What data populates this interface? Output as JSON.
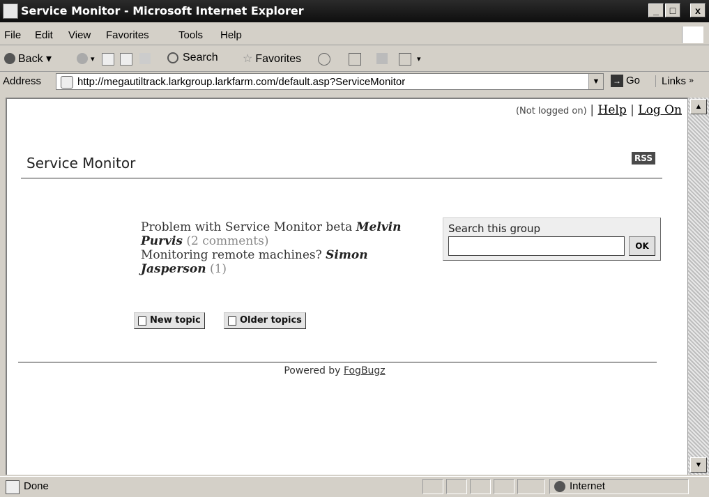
{
  "window": {
    "title": "Service Monitor - Microsoft Internet Explorer",
    "caption_buttons": [
      "_",
      "□",
      "x"
    ]
  },
  "menu": {
    "items": [
      "File",
      "Edit",
      "View",
      "Favorites",
      "Tools",
      "Help"
    ]
  },
  "toolbar": {
    "back_label": "Back",
    "search_label": "Search",
    "favorites_label": "Favorites"
  },
  "address": {
    "label": "Address",
    "url": "http://megautiltrack.larkgroup.larkfarm.com/default.asp?ServiceMonitor",
    "go_label": "Go",
    "links_label": "Links"
  },
  "page": {
    "login_status": "(Not logged on)",
    "help_link": "Help",
    "logon_link": "Log On",
    "title": "Service Monitor",
    "rss_label": "RSS",
    "topics": [
      {
        "title": "Problem with Service Monitor beta",
        "author": "Melvin Purvis",
        "comments": "(2 comments)"
      },
      {
        "title": "Monitoring remote machines?",
        "author": "Simon Jasperson",
        "comments": "(1)"
      }
    ],
    "search": {
      "label": "Search this group",
      "value": "",
      "button": "OK"
    },
    "new_topic_button": "New topic",
    "older_topics_button": "Older topics",
    "footer_text": "Powered by",
    "footer_link": "FogBugz"
  },
  "status": {
    "text": "Done",
    "zone": "Internet"
  }
}
